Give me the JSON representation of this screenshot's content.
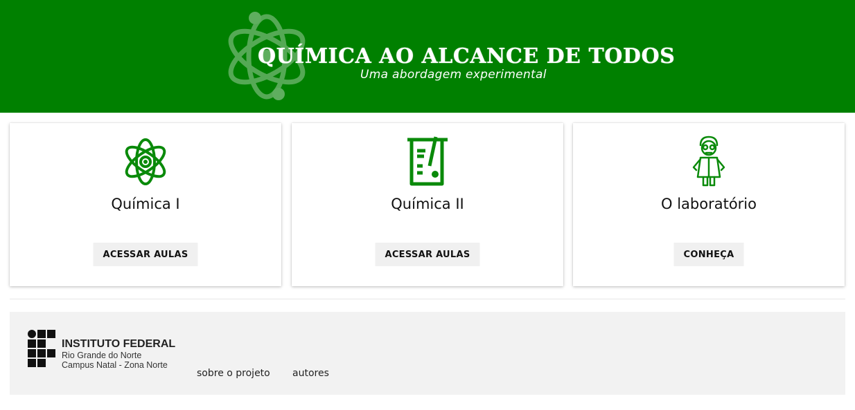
{
  "header": {
    "title": "QUÍMICA AO ALCANCE DE TODOS",
    "subtitle": "Uma abordagem experimental",
    "background_color": "#008000",
    "decor_icon": "atom-icon"
  },
  "cards": [
    {
      "title": "Química I",
      "button_label": "ACESSAR AULAS",
      "icon": "atom-icon"
    },
    {
      "title": "Química II",
      "button_label": "ACESSAR AULAS",
      "icon": "beaker-icon"
    },
    {
      "title": "O laboratório",
      "button_label": "CONHEÇA",
      "icon": "scientist-icon"
    }
  ],
  "footer": {
    "logo": {
      "title": "INSTITUTO FEDERAL",
      "line1": "Rio Grande do Norte",
      "line2": "Campus Natal - Zona Norte"
    },
    "links": [
      "sobre o projeto",
      "autores"
    ]
  },
  "colors": {
    "accent": "#008000",
    "button_bg": "#f0f0f0",
    "footer_bg": "#f2f2f2"
  }
}
